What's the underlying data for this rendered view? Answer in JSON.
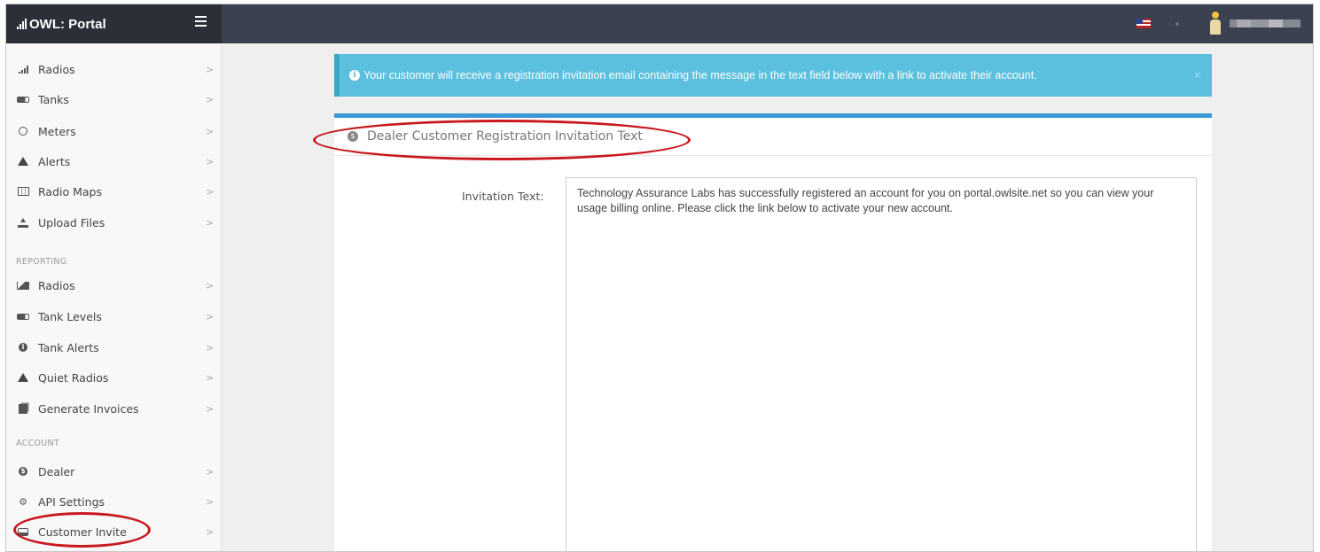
{
  "app": {
    "title": "OWL: Portal"
  },
  "sidebar": {
    "main_items": [
      {
        "label": "Radios",
        "icon": "signal-bars-icon"
      },
      {
        "label": "Tanks",
        "icon": "tank-icon"
      },
      {
        "label": "Meters",
        "icon": "gauge-icon"
      },
      {
        "label": "Alerts",
        "icon": "warning-icon"
      },
      {
        "label": "Radio Maps",
        "icon": "map-icon"
      },
      {
        "label": "Upload Files",
        "icon": "upload-icon"
      }
    ],
    "reporting_label": "REPORTING",
    "reporting_items": [
      {
        "label": "Radios",
        "icon": "area-chart-icon"
      },
      {
        "label": "Tank Levels",
        "icon": "tank-icon"
      },
      {
        "label": "Tank Alerts",
        "icon": "info-icon"
      },
      {
        "label": "Quiet Radios",
        "icon": "warning-icon"
      },
      {
        "label": "Generate Invoices",
        "icon": "copy-icon"
      }
    ],
    "account_label": "ACCOUNT",
    "account_items": [
      {
        "label": "Dealer",
        "icon": "dealer-icon"
      },
      {
        "label": "API Settings",
        "icon": "cogs-icon"
      },
      {
        "label": "Customer Invite",
        "icon": "inbox-icon"
      }
    ],
    "chevron": ">"
  },
  "alert": {
    "message": "Your customer will receive a registration invitation email containing the message in the text field below with a link to activate their account.",
    "close": "×"
  },
  "panel": {
    "title": "Dealer Customer Registration Invitation Text",
    "field_label": "Invitation Text:",
    "field_value": "Technology Assurance Labs has successfully registered an account for you on portal.owlsite.net so you can view your usage billing online.  Please click the link below to activate your new account."
  },
  "colors": {
    "topbar": "#3c4150",
    "brand": "#2c2f38",
    "alert": "#5bc0de",
    "panel_accent": "#3c97d6",
    "annotation": "#c8191f"
  }
}
